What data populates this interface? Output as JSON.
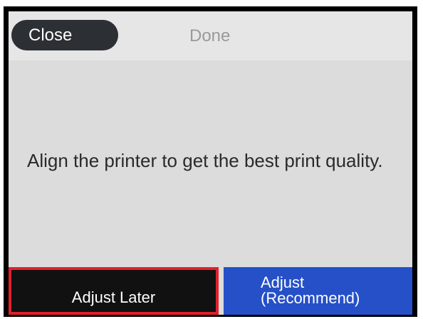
{
  "header": {
    "close_label": "Close",
    "title": "Done"
  },
  "message": "Align the printer to get the best print quality.",
  "buttons": {
    "adjust_later": "Adjust Later",
    "adjust_line1": "Adjust",
    "adjust_line2": "(Recommend)"
  },
  "colors": {
    "screen_bg": "#dcdcdc",
    "header_bg": "#e6e6e6",
    "close_bg": "#2c2f33",
    "adjust_later_bg": "#111111",
    "highlight_border": "#e0202b",
    "adjust_recommend_bg": "#2550c8"
  }
}
